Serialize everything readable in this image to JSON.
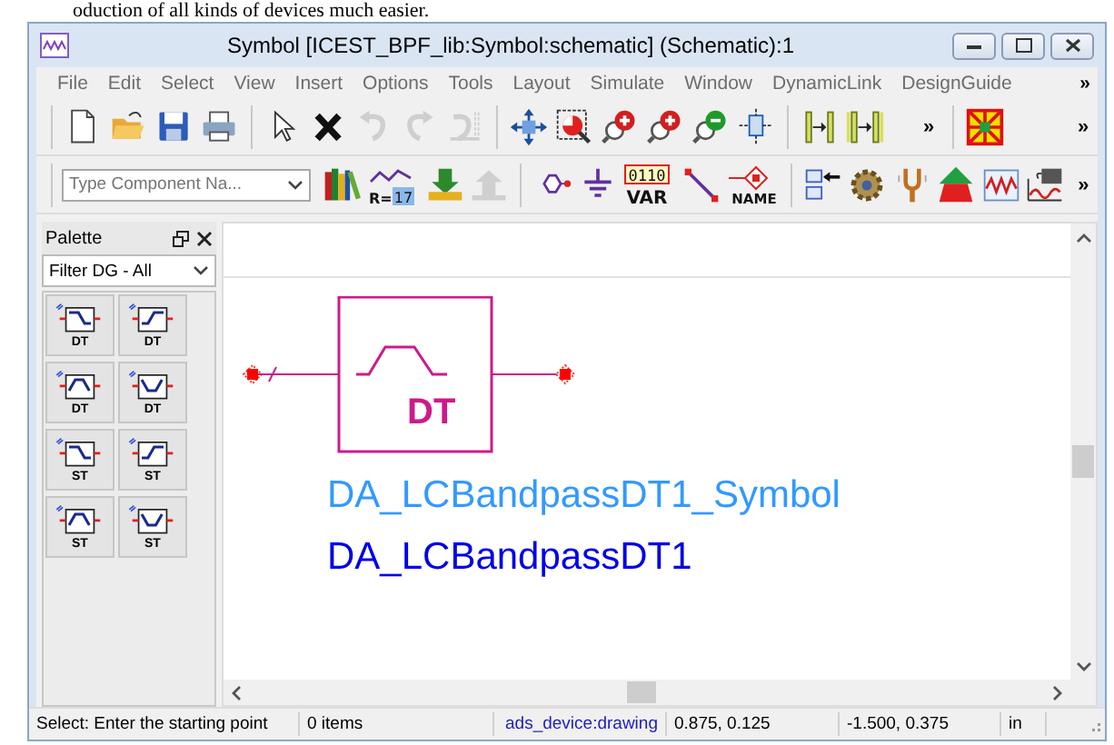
{
  "document_text": "oduction of all kinds of devices much easier.",
  "window": {
    "title": "Symbol [ICEST_BPF_lib:Symbol:schematic] (Schematic):1"
  },
  "menu": [
    "File",
    "Edit",
    "Select",
    "View",
    "Insert",
    "Options",
    "Tools",
    "Layout",
    "Simulate",
    "Window",
    "DynamicLink",
    "DesignGuide"
  ],
  "menu_more": "»",
  "toolbar_1": [
    {
      "kind": "new",
      "disabled": false
    },
    {
      "kind": "open",
      "disabled": false
    },
    {
      "kind": "save",
      "disabled": false
    },
    {
      "kind": "print",
      "disabled": false
    },
    {
      "kind": "sep"
    },
    {
      "kind": "pointer",
      "disabled": false
    },
    {
      "kind": "delete",
      "disabled": false
    },
    {
      "kind": "undo",
      "disabled": true
    },
    {
      "kind": "redo",
      "disabled": true
    },
    {
      "kind": "undo-all",
      "disabled": true
    },
    {
      "kind": "sep"
    },
    {
      "kind": "move",
      "disabled": false
    },
    {
      "kind": "zoom-area",
      "disabled": false
    },
    {
      "kind": "zoom-in",
      "disabled": false
    },
    {
      "kind": "zoom-in-2",
      "disabled": false
    },
    {
      "kind": "zoom-out-2",
      "disabled": false
    },
    {
      "kind": "pin",
      "disabled": false
    },
    {
      "kind": "sep"
    },
    {
      "kind": "push",
      "disabled": false
    },
    {
      "kind": "pop",
      "disabled": false
    },
    {
      "kind": "more",
      "label": "»",
      "disabled": false
    },
    {
      "kind": "sep"
    },
    {
      "kind": "cross-box",
      "disabled": false
    },
    {
      "kind": "more",
      "label": "»",
      "disabled": false
    }
  ],
  "component_field": {
    "placeholder": "Type Component Na..."
  },
  "toolbar_2": [
    {
      "kind": "library",
      "disabled": false
    },
    {
      "kind": "tune",
      "label": "R=",
      "value": "17",
      "disabled": false
    },
    {
      "kind": "download",
      "disabled": false
    },
    {
      "kind": "upload",
      "disabled": true
    },
    {
      "kind": "sep"
    },
    {
      "kind": "port",
      "disabled": false
    },
    {
      "kind": "ground",
      "disabled": false
    },
    {
      "kind": "var",
      "label": "0110",
      "value": "VAR",
      "disabled": false
    },
    {
      "kind": "wire",
      "disabled": false
    },
    {
      "kind": "name",
      "value": "NAME",
      "disabled": false
    },
    {
      "kind": "sep"
    },
    {
      "kind": "netlist",
      "disabled": false
    },
    {
      "kind": "gear",
      "disabled": false
    },
    {
      "kind": "tuning-fork",
      "disabled": false
    },
    {
      "kind": "arrow-up",
      "disabled": false
    },
    {
      "kind": "graph",
      "disabled": false
    },
    {
      "kind": "data",
      "disabled": false
    },
    {
      "kind": "more",
      "label": "»",
      "disabled": false
    }
  ],
  "palette": {
    "title": "Palette",
    "filter": "Filter DG - All",
    "items": [
      {
        "kind": "lowpass",
        "label": "DT"
      },
      {
        "kind": "highpass",
        "label": "DT"
      },
      {
        "kind": "bandpass",
        "label": "DT"
      },
      {
        "kind": "bandstop",
        "label": "DT"
      },
      {
        "kind": "lowpass",
        "label": "ST"
      },
      {
        "kind": "highpass",
        "label": "ST"
      },
      {
        "kind": "bandpass",
        "label": "ST"
      },
      {
        "kind": "bandstop",
        "label": "ST"
      }
    ]
  },
  "schematic": {
    "symbol_label": "DT",
    "labels": [
      {
        "text": "DA_LCBandpassDT1_Symbol",
        "color": "#3399ff"
      },
      {
        "text": "DA_LCBandpassDT1",
        "color": "#0000e6"
      }
    ]
  },
  "status_bar": [
    {
      "text": "Select: Enter the starting point",
      "kind": "plain"
    },
    {
      "text": "0 items",
      "kind": "plain"
    },
    {
      "text": "ads_device:drawing",
      "kind": "link"
    },
    {
      "text": "0.875, 0.125",
      "kind": "plain"
    },
    {
      "text": "-1.500, 0.375",
      "kind": "plain"
    },
    {
      "text": "in",
      "kind": "plain"
    }
  ]
}
